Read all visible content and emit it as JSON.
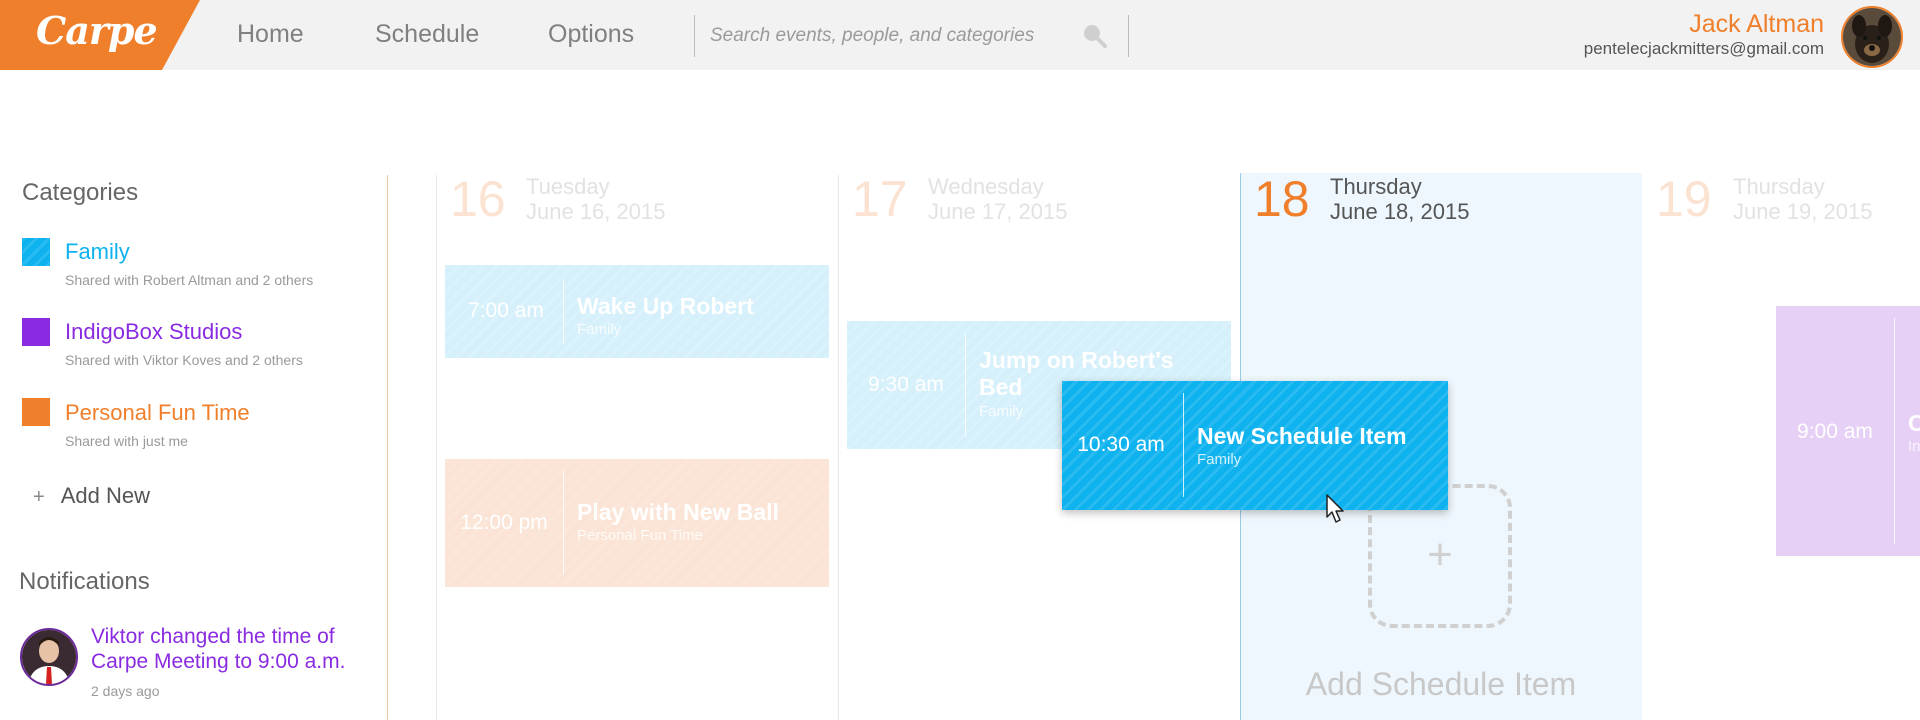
{
  "app": {
    "logo": "Carpe"
  },
  "nav": {
    "home": "Home",
    "schedule": "Schedule",
    "options": "Options"
  },
  "search": {
    "placeholder": "Search events, people, and categories"
  },
  "user": {
    "name": "Jack Altman",
    "email": "pentelecjackmitters@gmail.com"
  },
  "sidebar": {
    "categories_title": "Categories",
    "categories": [
      {
        "name": "Family",
        "shared": "Shared with Robert Altman and 2 others",
        "color": "#0db2ee"
      },
      {
        "name": "IndigoBox Studios",
        "shared": "Shared with Viktor Koves and 2 others",
        "color": "#8a2be2"
      },
      {
        "name": "Personal Fun Time",
        "shared": "Shared with just me",
        "color": "#f07f2b"
      }
    ],
    "add_new": "Add New",
    "add_new_icon": "+",
    "notifications_title": "Notifications",
    "notifications": [
      {
        "text": "Viktor changed the time of Carpe Meeting to 9:00 a.m.",
        "time": "2 days ago"
      }
    ]
  },
  "calendar": {
    "days": [
      {
        "num": "16",
        "weekday": "Tuesday",
        "date": "June 16, 2015",
        "today": false
      },
      {
        "num": "17",
        "weekday": "Wednesday",
        "date": "June 17, 2015",
        "today": false
      },
      {
        "num": "18",
        "weekday": "Thursday",
        "date": "June 18, 2015",
        "today": true
      },
      {
        "num": "19",
        "weekday": "Thursday",
        "date": "June 19, 2015",
        "today": false
      }
    ],
    "events": [
      {
        "time": "7:00 am",
        "title": "Wake Up Robert",
        "category": "Family",
        "color": "#d5f0fb"
      },
      {
        "time": "12:00 pm",
        "title": "Play with New Ball",
        "category": "Personal Fun Time",
        "color": "#fbe4d5"
      },
      {
        "time": "9:30 am",
        "title": "Jump on Robert's Bed",
        "category": "Family",
        "color": "#d5f0fb"
      },
      {
        "time": "10:30 am",
        "title": "New Schedule Item",
        "category": "Family",
        "color": "#0db2ee"
      },
      {
        "time": "9:00 am",
        "title": "Carpe Meeting",
        "category": "IndigoBox Studios",
        "color": "#e6d0f5"
      }
    ],
    "add_item_label": "Add Schedule Item",
    "add_item_icon": "+"
  }
}
